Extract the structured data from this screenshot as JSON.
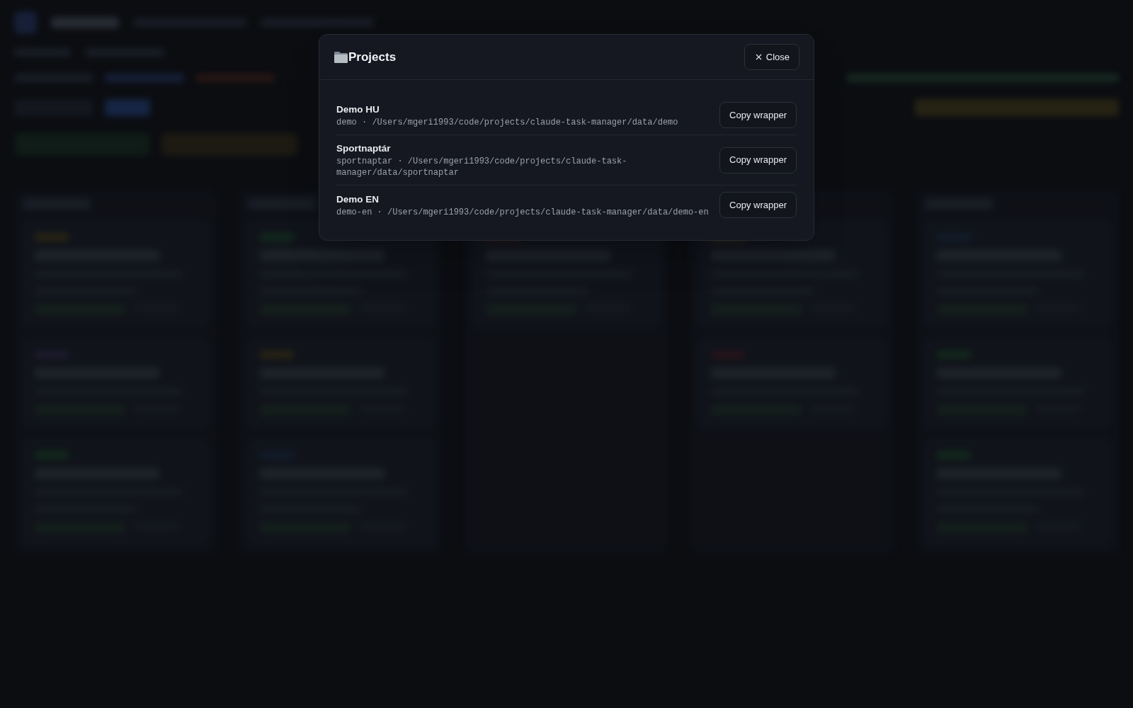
{
  "dialog": {
    "title": "Projects",
    "close_label": "Close",
    "projects": [
      {
        "name": "Demo HU",
        "location": "demo · /Users/mgeri1993/code/projects/claude-task-manager/data/demo",
        "action": "Copy wrapper"
      },
      {
        "name": "Sportnaptár",
        "location": "sportnaptar · /Users/mgeri1993/code/projects/claude-task-manager/data/sportnaptar",
        "action": "Copy wrapper"
      },
      {
        "name": "Demo EN",
        "location": "demo-en · /Users/mgeri1993/code/projects/claude-task-manager/data/demo-en",
        "action": "Copy wrapper"
      }
    ]
  }
}
